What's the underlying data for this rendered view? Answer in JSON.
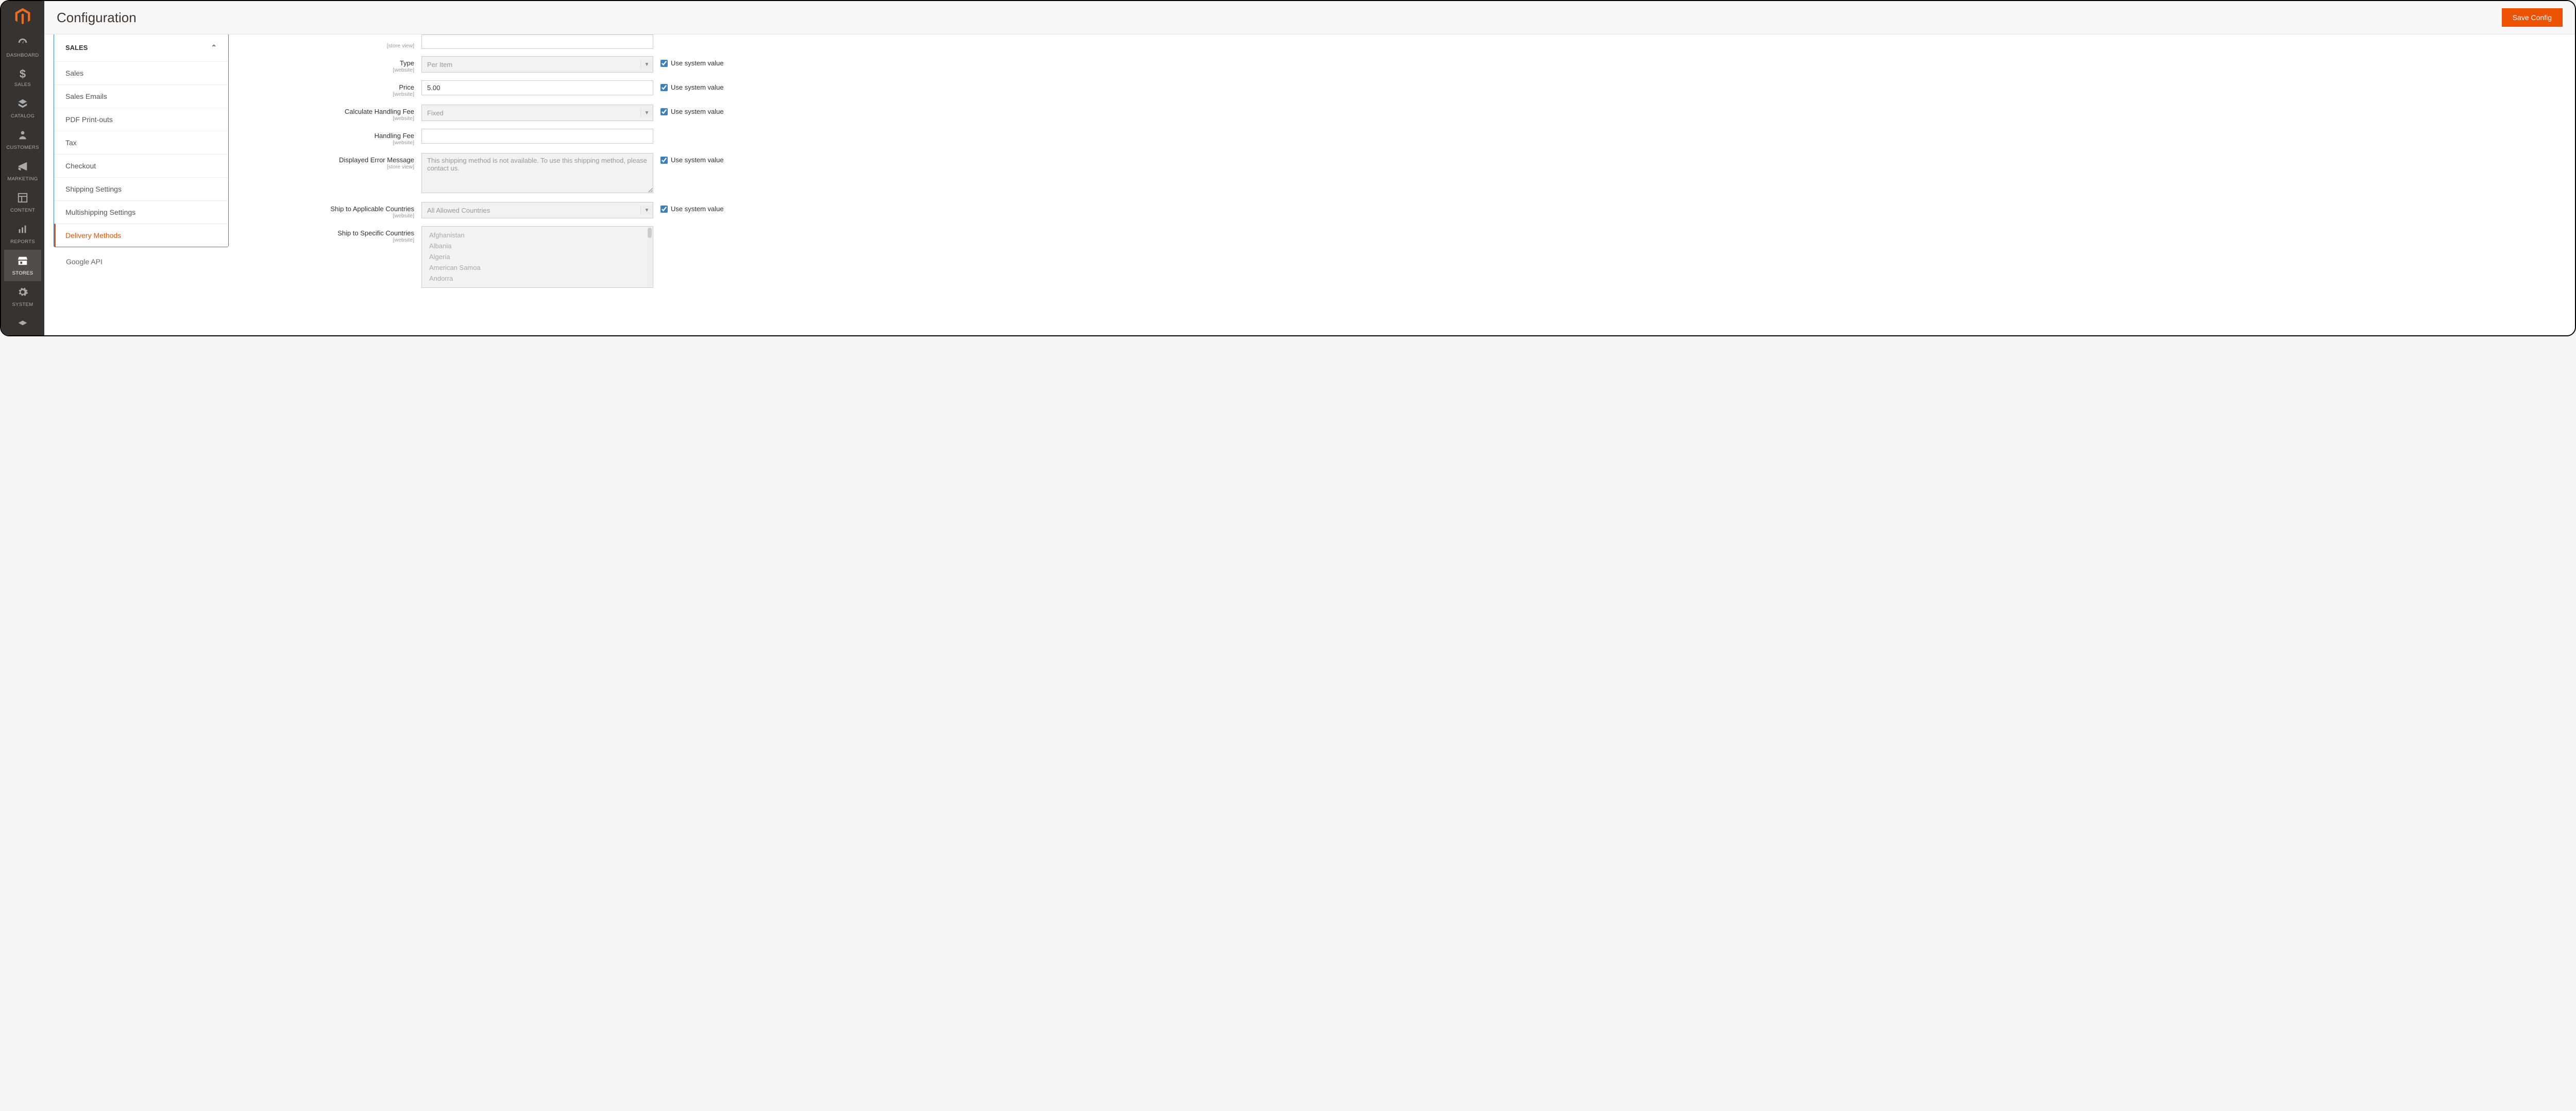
{
  "header": {
    "page_title": "Configuration",
    "save_button": "Save Config"
  },
  "leftnav": {
    "items": [
      {
        "label": "DASHBOARD",
        "icon": "dashboard"
      },
      {
        "label": "SALES",
        "icon": "dollar"
      },
      {
        "label": "CATALOG",
        "icon": "catalog"
      },
      {
        "label": "CUSTOMERS",
        "icon": "customers"
      },
      {
        "label": "MARKETING",
        "icon": "marketing"
      },
      {
        "label": "CONTENT",
        "icon": "content"
      },
      {
        "label": "REPORTS",
        "icon": "reports"
      },
      {
        "label": "STORES",
        "icon": "stores"
      },
      {
        "label": "SYSTEM",
        "icon": "system"
      }
    ]
  },
  "config_sidebar": {
    "group_title": "SALES",
    "items": [
      "Sales",
      "Sales Emails",
      "PDF Print-outs",
      "Tax",
      "Checkout",
      "Shipping Settings",
      "Multishipping Settings",
      "Delivery Methods"
    ],
    "active_index": 7,
    "after_items": [
      "Google API"
    ]
  },
  "form": {
    "use_system_label": "Use system value",
    "partial_top": {
      "scope": "[store view]",
      "value": ""
    },
    "rows": [
      {
        "label": "Type",
        "scope": "[website]",
        "kind": "select",
        "value": "Per Item",
        "disabled": true,
        "checked": true
      },
      {
        "label": "Price",
        "scope": "[website]",
        "kind": "text",
        "value": "5.00",
        "disabled": true,
        "checked": true
      },
      {
        "label": "Calculate Handling Fee",
        "scope": "[website]",
        "kind": "select",
        "value": "Fixed",
        "disabled": true,
        "checked": true
      },
      {
        "label": "Handling Fee",
        "scope": "[website]",
        "kind": "text",
        "value": "",
        "disabled": false,
        "checked": null
      },
      {
        "label": "Displayed Error Message",
        "scope": "[store view]",
        "kind": "textarea",
        "value": "This shipping method is not available. To use this shipping method, please contact us.",
        "disabled": true,
        "checked": true
      },
      {
        "label": "Ship to Applicable Countries",
        "scope": "[website]",
        "kind": "select",
        "value": "All Allowed Countries",
        "disabled": true,
        "checked": true
      },
      {
        "label": "Ship to Specific Countries",
        "scope": "[website]",
        "kind": "multiselect",
        "options": [
          "Afghanistan",
          "Albania",
          "Algeria",
          "American Samoa",
          "Andorra"
        ],
        "disabled": true,
        "checked": null
      }
    ]
  }
}
